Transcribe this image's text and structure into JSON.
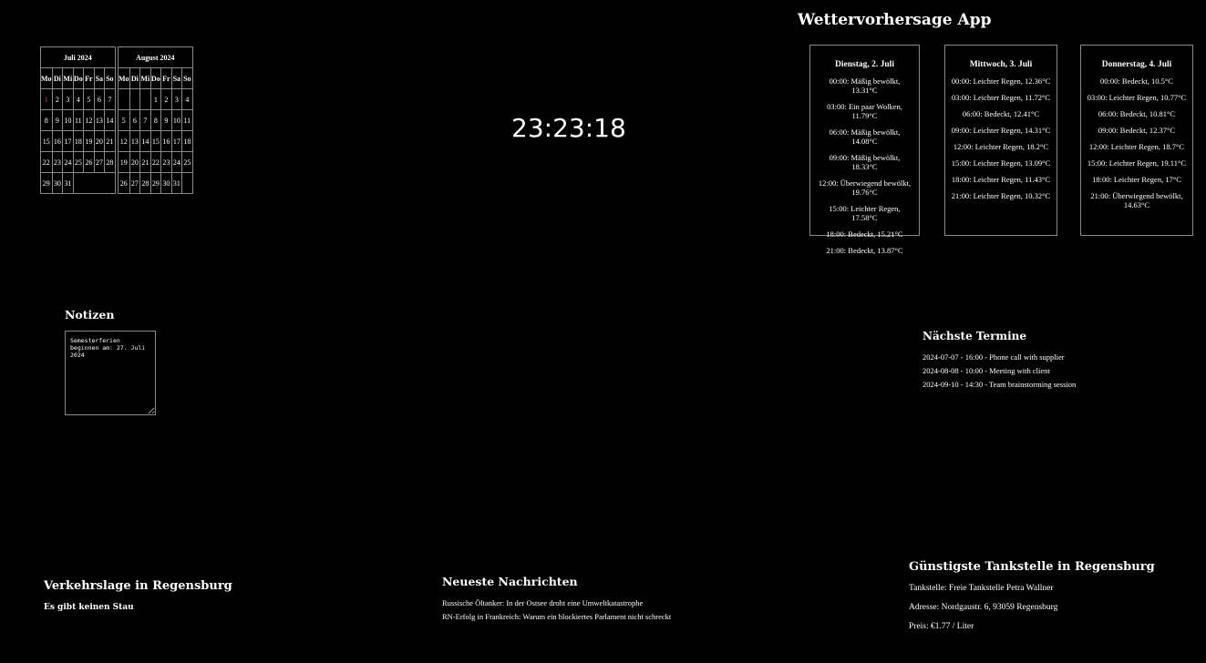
{
  "calendars": [
    {
      "title": "Juli 2024",
      "weekdays": [
        "Mo",
        "Di",
        "Mi",
        "Do",
        "Fr",
        "Sa",
        "So"
      ],
      "weeks": [
        [
          "1",
          "2",
          "3",
          "4",
          "5",
          "6",
          "7"
        ],
        [
          "8",
          "9",
          "10",
          "11",
          "12",
          "13",
          "14"
        ],
        [
          "15",
          "16",
          "17",
          "18",
          "19",
          "20",
          "21"
        ],
        [
          "22",
          "23",
          "24",
          "25",
          "26",
          "27",
          "28"
        ],
        [
          "29",
          "30",
          "31",
          "",
          "",
          "",
          ""
        ]
      ],
      "highlight_day": "1",
      "highlight_color": "#dd3333"
    },
    {
      "title": "August 2024",
      "weekdays": [
        "Mo",
        "Di",
        "Mi",
        "Do",
        "Fr",
        "Sa",
        "So"
      ],
      "weeks": [
        [
          "",
          "",
          "",
          "1",
          "2",
          "3",
          "4"
        ],
        [
          "5",
          "6",
          "7",
          "8",
          "9",
          "10",
          "11"
        ],
        [
          "12",
          "13",
          "14",
          "15",
          "16",
          "17",
          "18"
        ],
        [
          "19",
          "20",
          "21",
          "22",
          "23",
          "24",
          "25"
        ],
        [
          "26",
          "27",
          "28",
          "29",
          "30",
          "31",
          ""
        ]
      ]
    }
  ],
  "clock": {
    "time": "23:23:18"
  },
  "weather": {
    "title": "Wettervorhersage App",
    "days": [
      {
        "day": "Dienstag, 2. Juli",
        "entries": [
          "00:00: Mäßig bewölkt, 13.31°C",
          "03:00: Ein paar Wolken, 11.79°C",
          "06:00: Mäßig bewölkt, 14.08°C",
          "09:00: Mäßig bewölkt, 18.33°C",
          "12:00: Überwiegend bewölkt, 19.76°C",
          "15:00: Leichter Regen, 17.58°C",
          "18:00: Bedeckt, 15.21°C",
          "21:00: Bedeckt, 13.87°C"
        ]
      },
      {
        "day": "Mittwoch, 3. Juli",
        "entries": [
          "00:00: Leichter Regen, 12.36°C",
          "03:00: Leichter Regen, 11.72°C",
          "06:00: Bedeckt, 12.41°C",
          "09:00: Leichter Regen, 14.31°C",
          "12:00: Leichter Regen, 18.2°C",
          "15:00: Leichter Regen, 13.09°C",
          "18:00: Leichter Regen, 11.43°C",
          "21:00: Leichter Regen, 10.32°C"
        ]
      },
      {
        "day": "Donnerstag, 4. Juli",
        "entries": [
          "00:00: Bedeckt, 10.5°C",
          "03:00: Leichter Regen, 10.77°C",
          "06:00: Bedeckt, 10.81°C",
          "09:00: Bedeckt, 12.37°C",
          "12:00: Leichter Regen, 18.7°C",
          "15:00: Leichter Regen, 19.11°C",
          "18:00: Leichter Regen, 17°C",
          "21:00: Überwiegend bewölkt, 14.63°C"
        ]
      }
    ]
  },
  "notes": {
    "title": "Notizen",
    "value": "Semesterferien beginnen am: 27. Juli 2024"
  },
  "appointments": {
    "title": "Nächste Termine",
    "items": [
      "2024-07-07 - 16:00 - Phone call with supplier",
      "2024-08-08 - 10:00 - Meeting with client",
      "2024-09-10 - 14:30 - Team brainstorming session"
    ]
  },
  "traffic": {
    "title": "Verkehrslage in Regensburg",
    "status": "Es gibt keinen Stau"
  },
  "news": {
    "title": "Neueste Nachrichten",
    "items": [
      "Russische Öltanker: In der Ostsee droht eine Umweltkatastrophe",
      "RN-Erfolg in Frankreich: Warum ein blockiertes Parlament nicht schreckt"
    ]
  },
  "gas": {
    "title": "Günstigste Tankstelle in Regensburg",
    "station": "Tankstelle: Freie Tankstelle Petra Wallner",
    "address": "Adresse: Nordgaustr. 6, 93059 Regensburg",
    "price": "Preis: €1.77 / Liter"
  }
}
